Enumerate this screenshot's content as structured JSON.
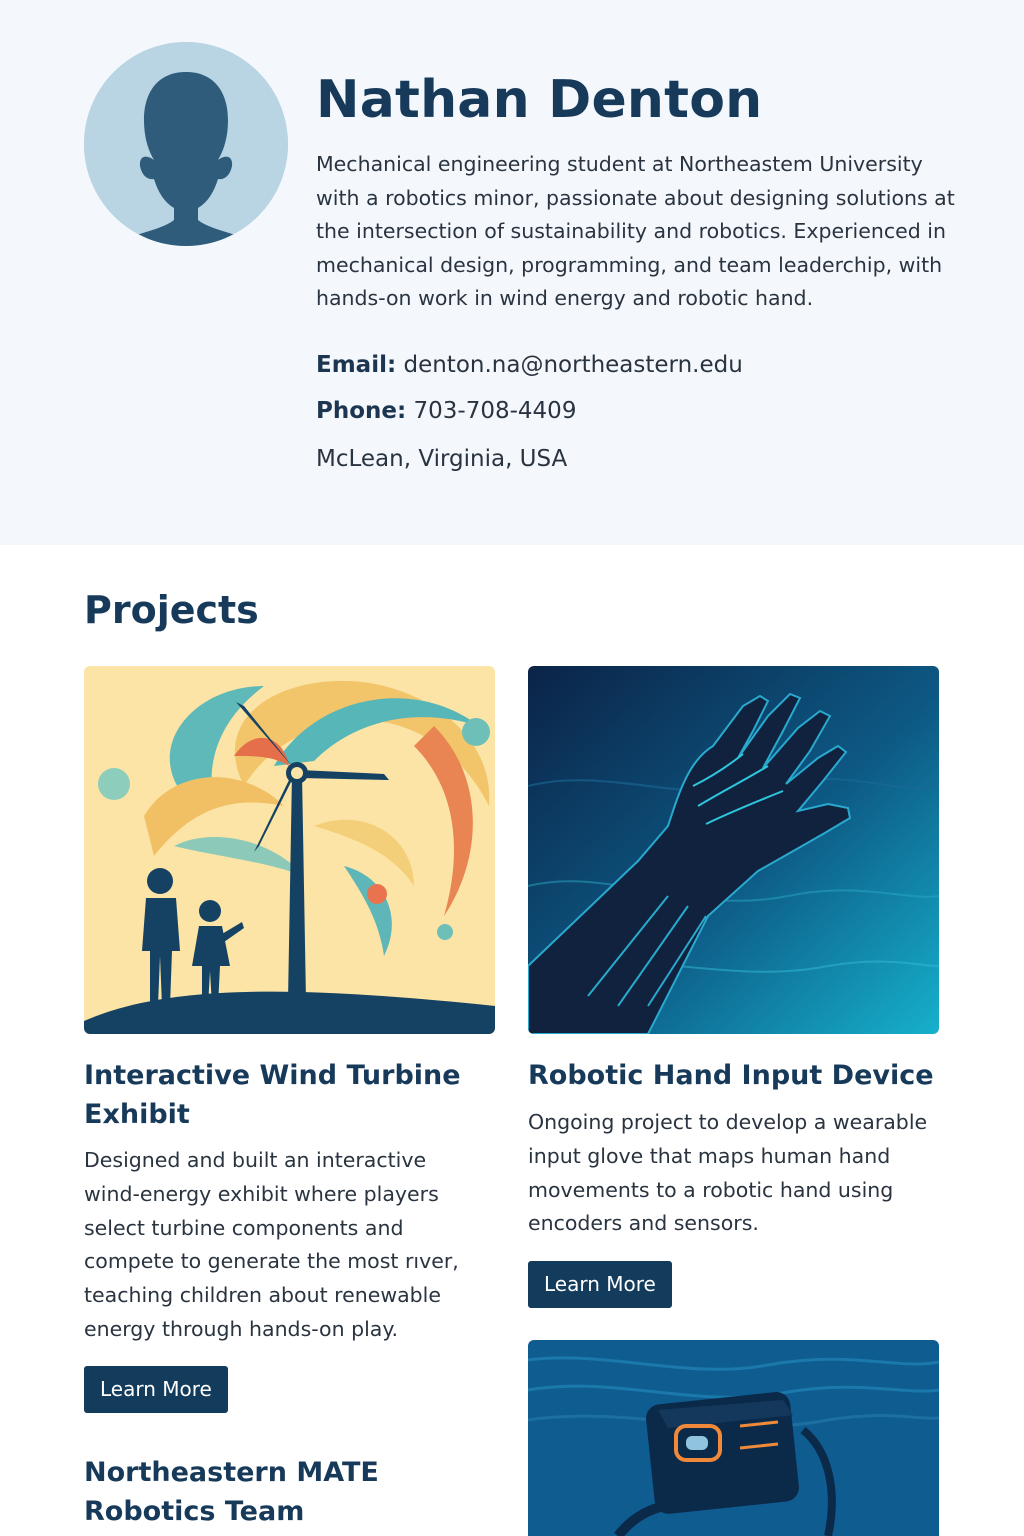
{
  "profile": {
    "name": "Nathan Denton",
    "bio": "Mechanical engineering student at Northeastem University with a robotics minor, passionate about designing solutions at the intersection of sustainability and robotics. Experienced in mechanical design, programming, and team leaderchip, with hands-on work in wind energy and robotic hand.",
    "email_label": "Email:",
    "email": "denton.na@northeastern.edu",
    "phone_label": "Phone:",
    "phone": "703-708-4409",
    "location": "McLean, Virginia, USA"
  },
  "projects": {
    "heading": "Projects",
    "items": [
      {
        "title": "Interactive Wind Turbine Exhibit",
        "description": "Designed and built an interactive wind-energy exhibit where players select turbine components and compete to generate the most rıver, teaching children about renewable energy through hands-on play.",
        "button": "Learn More",
        "image": "wind-turbine-illustration"
      },
      {
        "title": "Robotic Hand Input Device",
        "description": "Ongoing project to develop a wearable input glove that maps human hand movements to a robotic hand using encoders and sensors.",
        "button": "Learn More",
        "image": "robotic-hand-illustration"
      },
      {
        "title": "Northeastern MATE Robotics Team",
        "image": "underwater-robot-illustration"
      }
    ]
  },
  "colors": {
    "accent": "#173a5a",
    "button": "#133b5c",
    "hero_bg": "#f4f8fc"
  }
}
